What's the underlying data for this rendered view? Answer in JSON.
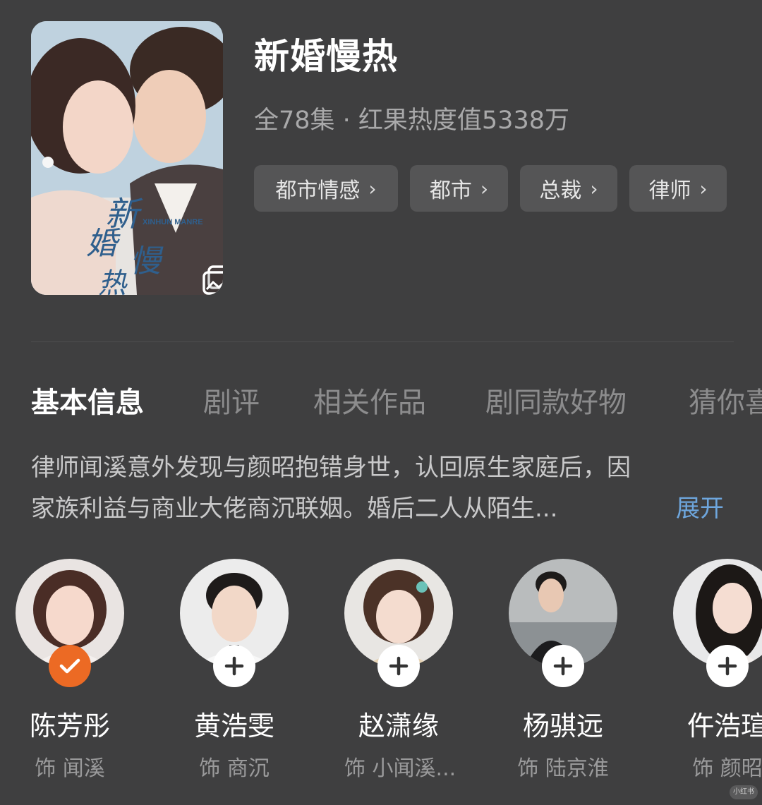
{
  "drama": {
    "title": "新婚慢热",
    "meta": "全78集 · 红果热度值5338万",
    "poster_caption": "XINHUN MANRE"
  },
  "tags": [
    "都市情感",
    "都市",
    "总裁",
    "律师"
  ],
  "tabs": [
    "基本信息",
    "剧评",
    "相关作品",
    "剧同款好物",
    "猜你喜"
  ],
  "active_tab": "基本信息",
  "synopsis": {
    "line1": "律师闻溪意外发现与颜昭抱错身世，认回原生家庭后，因",
    "line2": "家族利益与商业大佬商沉联姻。婚后二人从陌生...",
    "expand_label": "展开"
  },
  "cast": [
    {
      "name": "陈芳彤",
      "role": "饰 闻溪",
      "followed": true
    },
    {
      "name": "黄浩雯",
      "role": "饰 商沉",
      "followed": false
    },
    {
      "name": "赵潇缘",
      "role": "饰 小闻溪...",
      "followed": false
    },
    {
      "name": "杨骐远",
      "role": "饰 陆京淮",
      "followed": false
    },
    {
      "name": "仵浩瑄",
      "role": "饰 颜昭",
      "followed": false
    }
  ],
  "icons": {
    "tag_chevron": "chevron-right-icon",
    "gallery": "gallery-icon",
    "follow_add": "plus-icon",
    "followed": "check-icon"
  },
  "colors": {
    "background": "#3f3f40",
    "accent_link": "#6ea6dd",
    "followed_badge": "#ec6a24"
  },
  "watermark": "小红书"
}
